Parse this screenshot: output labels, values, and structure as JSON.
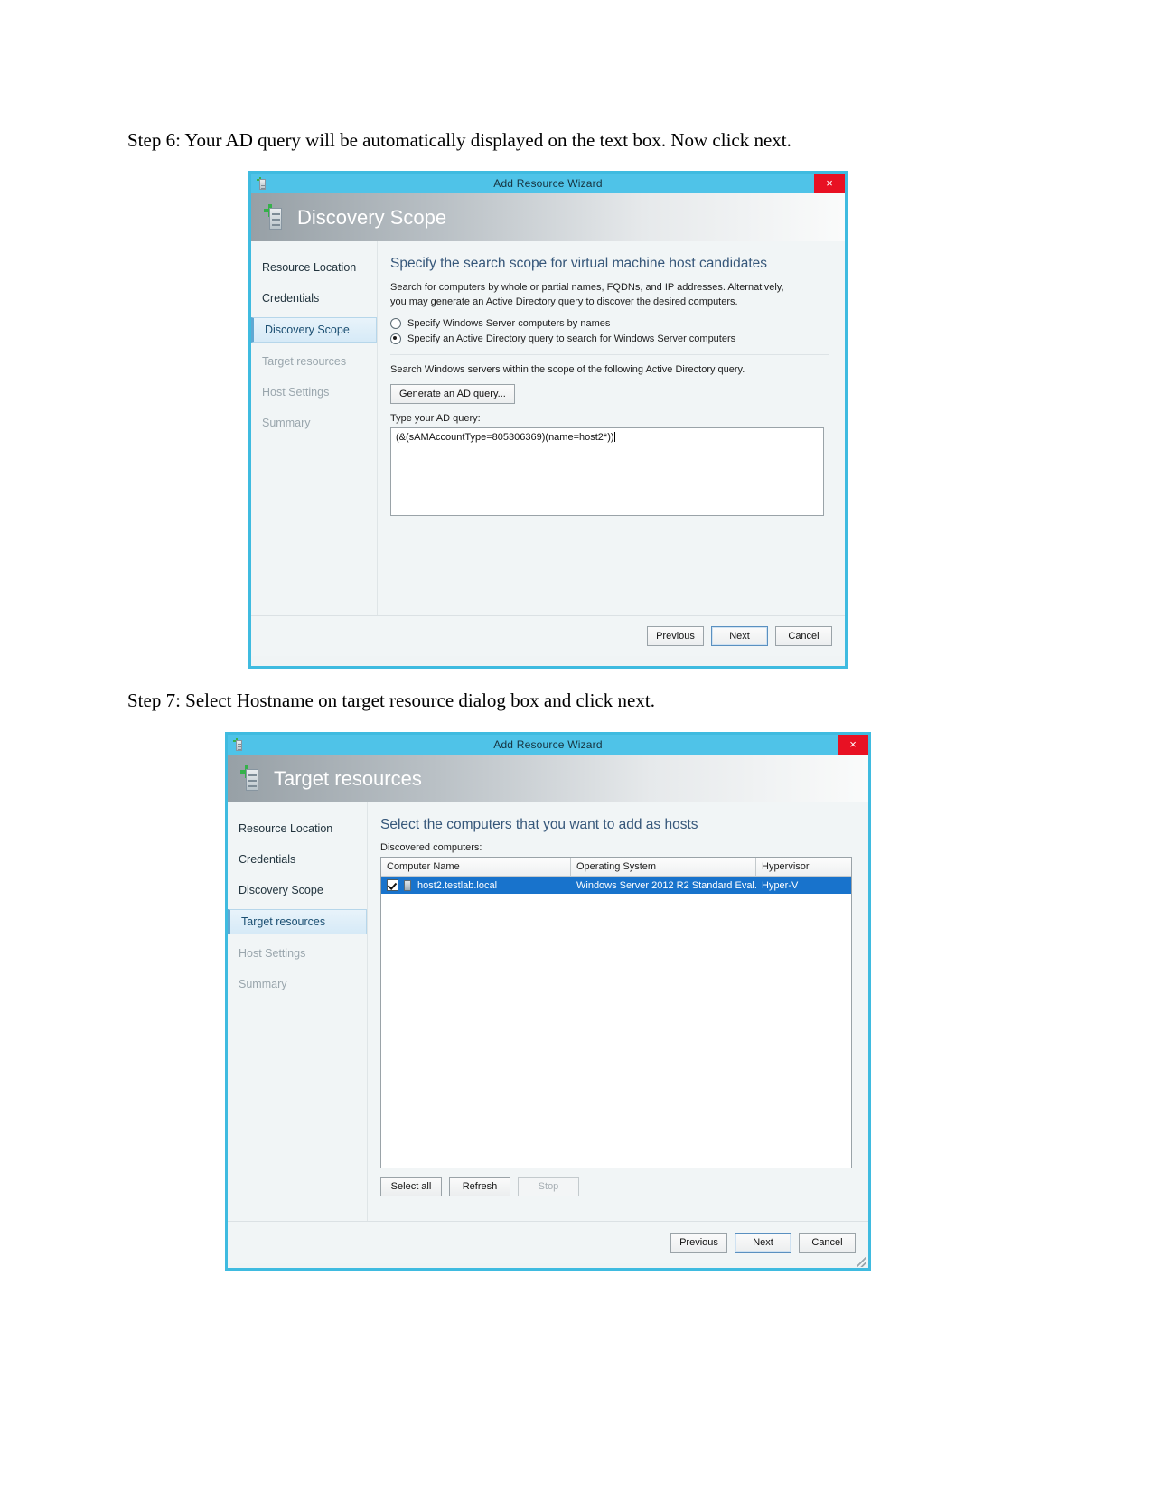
{
  "steps": {
    "step6": "Step 6: Your AD query will be automatically displayed on the text box. Now click next.",
    "step7": "Step 7: Select Hostname on target resource dialog box and click next."
  },
  "colors": {
    "title_bar": "#4fc3e8",
    "close_button": "#e81123",
    "heading_text": "#36577a",
    "selection_blue": "#1873cc",
    "active_nav": "#d6eaf7"
  },
  "dialog1": {
    "window_title": "Add Resource Wizard",
    "close_label": "×",
    "header_title": "Discovery Scope",
    "nav": [
      {
        "label": "Resource Location",
        "state": "done"
      },
      {
        "label": "Credentials",
        "state": "done"
      },
      {
        "label": "Discovery Scope",
        "state": "active"
      },
      {
        "label": "Target resources",
        "state": "disabled"
      },
      {
        "label": "Host Settings",
        "state": "disabled"
      },
      {
        "label": "Summary",
        "state": "disabled"
      }
    ],
    "heading": "Specify the search scope for virtual machine host candidates",
    "paragraph": "Search for computers by whole or partial names, FQDNs, and IP addresses. Alternatively, you may generate an Active Directory query to discover the desired computers.",
    "radio_names_label": "Specify Windows Server computers by names",
    "radio_query_label": "Specify an Active Directory query to search for Windows Server computers",
    "radio_selected": "query",
    "scope_text": "Search Windows servers within the scope of the following Active Directory query.",
    "generate_button": "Generate an AD query...",
    "query_label": "Type your AD query:",
    "query_value": "(&(sAMAccountType=805306369)(name=host2*))",
    "footer": {
      "previous": "Previous",
      "next": "Next",
      "cancel": "Cancel"
    }
  },
  "dialog2": {
    "window_title": "Add Resource Wizard",
    "close_label": "×",
    "header_title": "Target resources",
    "nav": [
      {
        "label": "Resource Location",
        "state": "done"
      },
      {
        "label": "Credentials",
        "state": "done"
      },
      {
        "label": "Discovery Scope",
        "state": "done"
      },
      {
        "label": "Target resources",
        "state": "active"
      },
      {
        "label": "Host Settings",
        "state": "disabled"
      },
      {
        "label": "Summary",
        "state": "disabled"
      }
    ],
    "heading": "Select the computers that you want to add as hosts",
    "list_label": "Discovered computers:",
    "columns": [
      "Computer Name",
      "Operating System",
      "Hypervisor"
    ],
    "rows": [
      {
        "checked": true,
        "computer_name": "host2.testlab.local",
        "operating_system": "Windows Server 2012 R2 Standard Eval...",
        "hypervisor": "Hyper-V",
        "selected": true
      }
    ],
    "actions": {
      "select_all": "Select all",
      "refresh": "Refresh",
      "stop": "Stop",
      "stop_disabled": true
    },
    "footer": {
      "previous": "Previous",
      "next": "Next",
      "cancel": "Cancel"
    }
  }
}
